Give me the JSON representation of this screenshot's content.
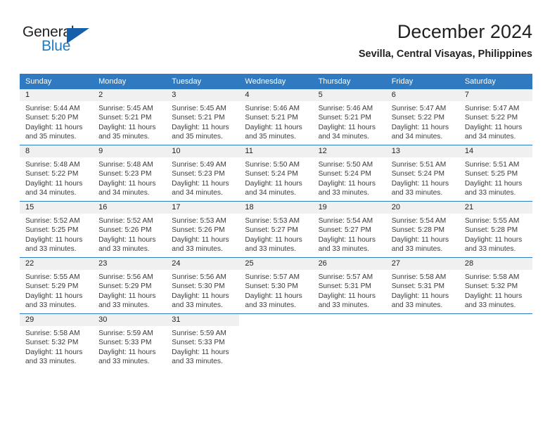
{
  "logo": {
    "word_top": "General",
    "word_bottom": "Blue",
    "triangle_icon": "triangle-icon",
    "brand_color": "#1f7ac2"
  },
  "header": {
    "title": "December 2024",
    "subtitle": "Sevilla, Central Visayas, Philippines"
  },
  "colors": {
    "header_blue": "#2f7ac0",
    "daynum_band": "#f0f0f0",
    "text": "#231f20"
  },
  "calendar": {
    "weekday_headers": [
      "Sunday",
      "Monday",
      "Tuesday",
      "Wednesday",
      "Thursday",
      "Friday",
      "Saturday"
    ],
    "weeks": [
      [
        {
          "day": "1",
          "sunrise": "Sunrise: 5:44 AM",
          "sunset": "Sunset: 5:20 PM",
          "daylight": "Daylight: 11 hours and 35 minutes."
        },
        {
          "day": "2",
          "sunrise": "Sunrise: 5:45 AM",
          "sunset": "Sunset: 5:21 PM",
          "daylight": "Daylight: 11 hours and 35 minutes."
        },
        {
          "day": "3",
          "sunrise": "Sunrise: 5:45 AM",
          "sunset": "Sunset: 5:21 PM",
          "daylight": "Daylight: 11 hours and 35 minutes."
        },
        {
          "day": "4",
          "sunrise": "Sunrise: 5:46 AM",
          "sunset": "Sunset: 5:21 PM",
          "daylight": "Daylight: 11 hours and 35 minutes."
        },
        {
          "day": "5",
          "sunrise": "Sunrise: 5:46 AM",
          "sunset": "Sunset: 5:21 PM",
          "daylight": "Daylight: 11 hours and 34 minutes."
        },
        {
          "day": "6",
          "sunrise": "Sunrise: 5:47 AM",
          "sunset": "Sunset: 5:22 PM",
          "daylight": "Daylight: 11 hours and 34 minutes."
        },
        {
          "day": "7",
          "sunrise": "Sunrise: 5:47 AM",
          "sunset": "Sunset: 5:22 PM",
          "daylight": "Daylight: 11 hours and 34 minutes."
        }
      ],
      [
        {
          "day": "8",
          "sunrise": "Sunrise: 5:48 AM",
          "sunset": "Sunset: 5:22 PM",
          "daylight": "Daylight: 11 hours and 34 minutes."
        },
        {
          "day": "9",
          "sunrise": "Sunrise: 5:48 AM",
          "sunset": "Sunset: 5:23 PM",
          "daylight": "Daylight: 11 hours and 34 minutes."
        },
        {
          "day": "10",
          "sunrise": "Sunrise: 5:49 AM",
          "sunset": "Sunset: 5:23 PM",
          "daylight": "Daylight: 11 hours and 34 minutes."
        },
        {
          "day": "11",
          "sunrise": "Sunrise: 5:50 AM",
          "sunset": "Sunset: 5:24 PM",
          "daylight": "Daylight: 11 hours and 34 minutes."
        },
        {
          "day": "12",
          "sunrise": "Sunrise: 5:50 AM",
          "sunset": "Sunset: 5:24 PM",
          "daylight": "Daylight: 11 hours and 33 minutes."
        },
        {
          "day": "13",
          "sunrise": "Sunrise: 5:51 AM",
          "sunset": "Sunset: 5:24 PM",
          "daylight": "Daylight: 11 hours and 33 minutes."
        },
        {
          "day": "14",
          "sunrise": "Sunrise: 5:51 AM",
          "sunset": "Sunset: 5:25 PM",
          "daylight": "Daylight: 11 hours and 33 minutes."
        }
      ],
      [
        {
          "day": "15",
          "sunrise": "Sunrise: 5:52 AM",
          "sunset": "Sunset: 5:25 PM",
          "daylight": "Daylight: 11 hours and 33 minutes."
        },
        {
          "day": "16",
          "sunrise": "Sunrise: 5:52 AM",
          "sunset": "Sunset: 5:26 PM",
          "daylight": "Daylight: 11 hours and 33 minutes."
        },
        {
          "day": "17",
          "sunrise": "Sunrise: 5:53 AM",
          "sunset": "Sunset: 5:26 PM",
          "daylight": "Daylight: 11 hours and 33 minutes."
        },
        {
          "day": "18",
          "sunrise": "Sunrise: 5:53 AM",
          "sunset": "Sunset: 5:27 PM",
          "daylight": "Daylight: 11 hours and 33 minutes."
        },
        {
          "day": "19",
          "sunrise": "Sunrise: 5:54 AM",
          "sunset": "Sunset: 5:27 PM",
          "daylight": "Daylight: 11 hours and 33 minutes."
        },
        {
          "day": "20",
          "sunrise": "Sunrise: 5:54 AM",
          "sunset": "Sunset: 5:28 PM",
          "daylight": "Daylight: 11 hours and 33 minutes."
        },
        {
          "day": "21",
          "sunrise": "Sunrise: 5:55 AM",
          "sunset": "Sunset: 5:28 PM",
          "daylight": "Daylight: 11 hours and 33 minutes."
        }
      ],
      [
        {
          "day": "22",
          "sunrise": "Sunrise: 5:55 AM",
          "sunset": "Sunset: 5:29 PM",
          "daylight": "Daylight: 11 hours and 33 minutes."
        },
        {
          "day": "23",
          "sunrise": "Sunrise: 5:56 AM",
          "sunset": "Sunset: 5:29 PM",
          "daylight": "Daylight: 11 hours and 33 minutes."
        },
        {
          "day": "24",
          "sunrise": "Sunrise: 5:56 AM",
          "sunset": "Sunset: 5:30 PM",
          "daylight": "Daylight: 11 hours and 33 minutes."
        },
        {
          "day": "25",
          "sunrise": "Sunrise: 5:57 AM",
          "sunset": "Sunset: 5:30 PM",
          "daylight": "Daylight: 11 hours and 33 minutes."
        },
        {
          "day": "26",
          "sunrise": "Sunrise: 5:57 AM",
          "sunset": "Sunset: 5:31 PM",
          "daylight": "Daylight: 11 hours and 33 minutes."
        },
        {
          "day": "27",
          "sunrise": "Sunrise: 5:58 AM",
          "sunset": "Sunset: 5:31 PM",
          "daylight": "Daylight: 11 hours and 33 minutes."
        },
        {
          "day": "28",
          "sunrise": "Sunrise: 5:58 AM",
          "sunset": "Sunset: 5:32 PM",
          "daylight": "Daylight: 11 hours and 33 minutes."
        }
      ],
      [
        {
          "day": "29",
          "sunrise": "Sunrise: 5:58 AM",
          "sunset": "Sunset: 5:32 PM",
          "daylight": "Daylight: 11 hours and 33 minutes."
        },
        {
          "day": "30",
          "sunrise": "Sunrise: 5:59 AM",
          "sunset": "Sunset: 5:33 PM",
          "daylight": "Daylight: 11 hours and 33 minutes."
        },
        {
          "day": "31",
          "sunrise": "Sunrise: 5:59 AM",
          "sunset": "Sunset: 5:33 PM",
          "daylight": "Daylight: 11 hours and 33 minutes."
        },
        {
          "day": "",
          "sunrise": "",
          "sunset": "",
          "daylight": ""
        },
        {
          "day": "",
          "sunrise": "",
          "sunset": "",
          "daylight": ""
        },
        {
          "day": "",
          "sunrise": "",
          "sunset": "",
          "daylight": ""
        },
        {
          "day": "",
          "sunrise": "",
          "sunset": "",
          "daylight": ""
        }
      ]
    ]
  }
}
